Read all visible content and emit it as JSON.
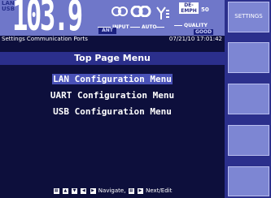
{
  "header": {
    "lan_usb": [
      "LAN",
      "USB"
    ],
    "frequency": "103.9",
    "input_label": "INPUT",
    "auto_label": "AUTO",
    "ant_label": "ANT",
    "deemph_label": [
      "DE-",
      "EMPH"
    ],
    "deemph_value": "50",
    "quality_label": "QUALITY",
    "quality_value": "GOOD"
  },
  "status_line": {
    "breadcrumb": "Settings Communication Ports",
    "timestamp": "07/21/10  17:01:42"
  },
  "page": {
    "title": "Top Page Menu",
    "menu_items": [
      {
        "label": "LAN Configuration Menu"
      },
      {
        "label": "UART Configuration Menu"
      },
      {
        "label": "USB Configuration Menu"
      }
    ],
    "selected_index": 0
  },
  "hint": {
    "nav_text": "Navigate,",
    "next_text": "Next/Edit"
  },
  "side_buttons": [
    {
      "label": "SETTINGS"
    },
    {
      "label": ""
    },
    {
      "label": ""
    },
    {
      "label": ""
    },
    {
      "label": ""
    }
  ],
  "colors": {
    "screen_bg": "#0d0f3c",
    "header_bg": "#6f77c9",
    "accent": "#2b2f8c",
    "selected": "#4a52b8"
  }
}
